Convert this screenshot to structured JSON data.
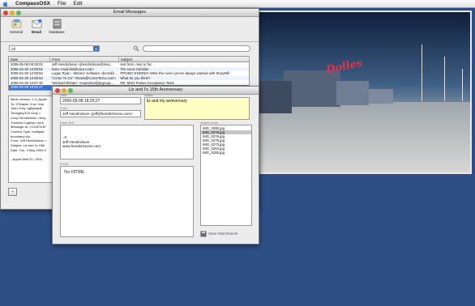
{
  "menubar": {
    "app": "CompassOSX",
    "items": [
      "File",
      "Edit"
    ]
  },
  "main_window": {
    "title": "Email Messages",
    "toolbar": [
      {
        "label": "General",
        "icon": "general-icon"
      },
      {
        "label": "Email",
        "icon": "email-icon"
      },
      {
        "label": "Database",
        "icon": "database-icon"
      }
    ],
    "filter_value": "All",
    "columns": [
      "Date",
      "From",
      "Subject"
    ],
    "rows": [
      {
        "date": "2006-05-08 08:28:02",
        "from": "Jeff Hendrickson <jhendrickson@mac...",
        "subject": "test from .mac to fnc"
      },
      {
        "date": "2006-04-30 12:08:52",
        "from": "Nora <mail-list@nora.com>",
        "subject": "The Nora Outsider"
      },
      {
        "date": "2006-04-30 12:08:52",
        "from": "Logan Ryan - Mariner Software <bend@...",
        "subject": "PROMO ENDING! Write the novel you've always wanted with StoryMill"
      },
      {
        "date": "2006-04-30 12:08:52",
        "from": "\"Come To Go\" <News@ComeToGo.com>",
        "subject": "What do you think?"
      },
      {
        "date": "2006-04-30 12:57:30",
        "from": "\"Michael Rhinter\" <mprenter@prgroup...",
        "subject": "RE: MSG Poster Acceptance Tests"
      },
      {
        "date": "2006-05-08 18:25:27",
        "from": "jeff.hendrickson <jeff@hendricksons...",
        "subject": "Liz and I's 15th Anniversary"
      }
    ],
    "raw_lines": [
      "Mime-Version: 1.0 (Apple",
      "To: D'Wayne Cruz <tep",
      "Joan Gray <jgbgray@",
      "Tonegary/115 Gray <",
      "Lizzy Hendrickson <lizzy",
      "Theresa Coghlan <tere",
      "Message-Id: <C44F3187",
      "Content-Type: multipart",
      "     boundary=Ap",
      "From: Jeff Hendrickson <",
      "Subject: Liz and I's 15th",
      "Date: Tue, 9 May 2006 0",
      "",
      "--Apple-Mail-31--1304"
    ],
    "minus_button": "−"
  },
  "detail_window": {
    "title": "Liz and I's 15th Anniversary",
    "date_label": "Date",
    "date_value": "2006-05-08 18:25:27",
    "from_label": "From",
    "from_value": "Jeff Hendrickson <jeff@hendricksons.com>",
    "notes_label": "Notes",
    "notes_value": "liz and my anniversary",
    "plain_label": "Plain Text",
    "plain_lines": [
      "",
      "",
      "-Jr",
      "Jeff Hendrickson",
      "www.hendricksons.com"
    ],
    "html_label": "HTML",
    "html_value": "No HTML",
    "attach_label": "Attachments",
    "attachments": [
      "IMG_0280.jpg",
      "IMG_0278.jpg",
      "IMG_0276.jpg",
      "IMG_0275.jpg",
      "IMG_0273.jpg",
      "IMG_0284.jpg",
      "IMG_0285.jpg"
    ],
    "save_label": "Save Attachments"
  }
}
